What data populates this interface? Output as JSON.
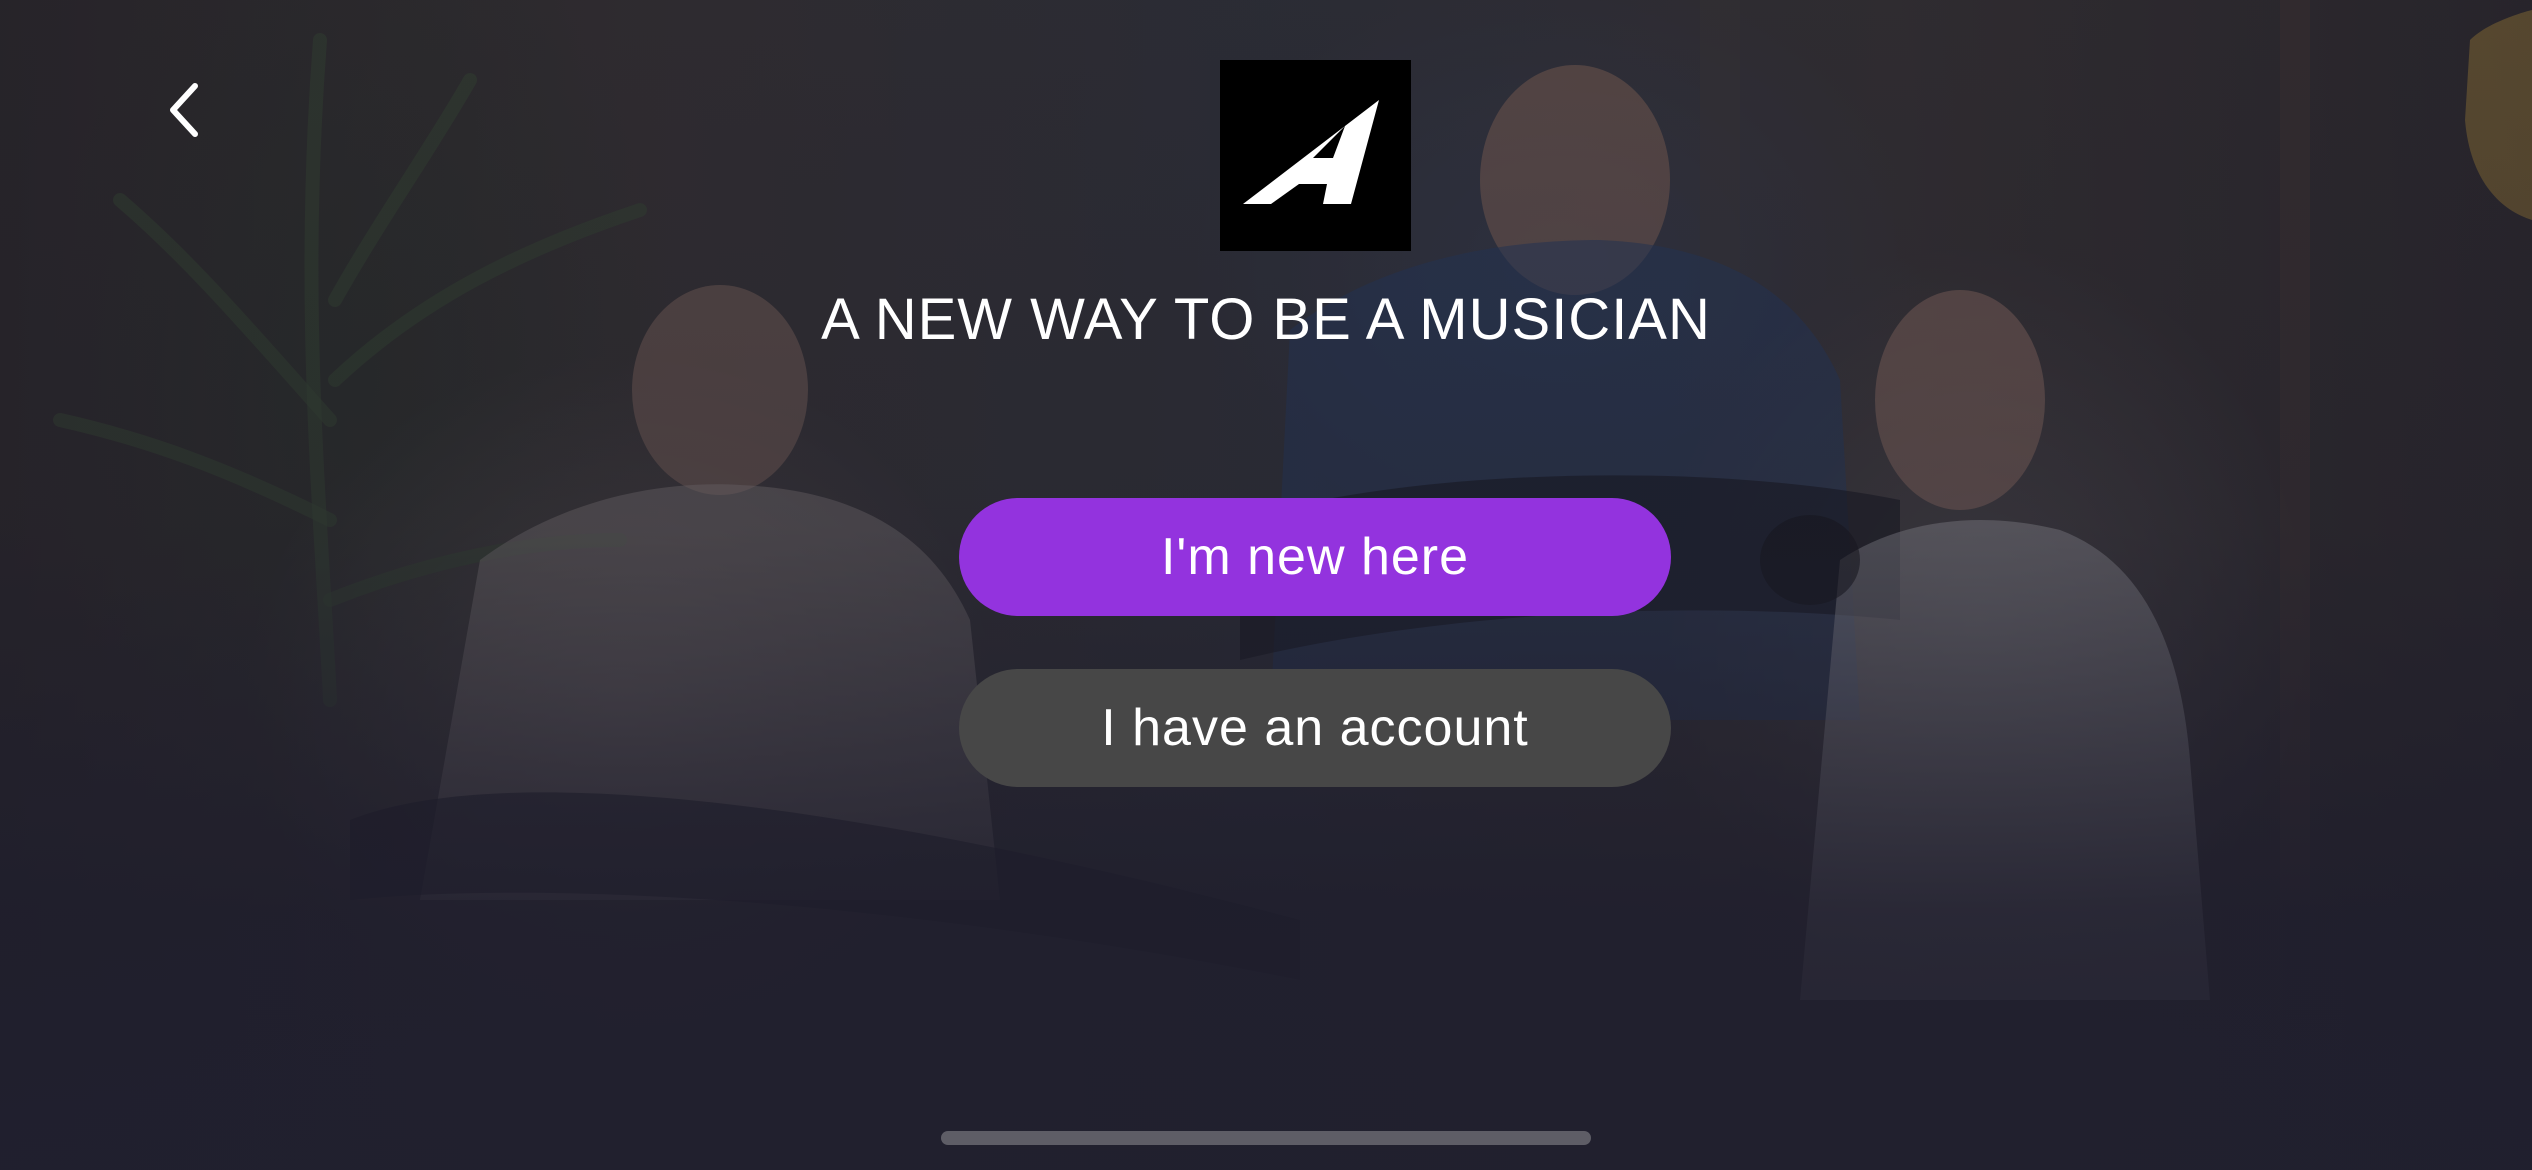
{
  "screen": {
    "headline": "A NEW WAY TO BE A MUSICIAN"
  },
  "navigation": {
    "back_icon": "chevron-left-icon"
  },
  "logo": {
    "letter": "A",
    "icon": "brand-logo-icon"
  },
  "actions": {
    "new_user_label": "I'm new here",
    "existing_user_label": "I have an account"
  },
  "colors": {
    "primary_button": "#9333de",
    "secondary_button": "#474747",
    "text": "#ffffff",
    "logo_background": "#000000"
  }
}
